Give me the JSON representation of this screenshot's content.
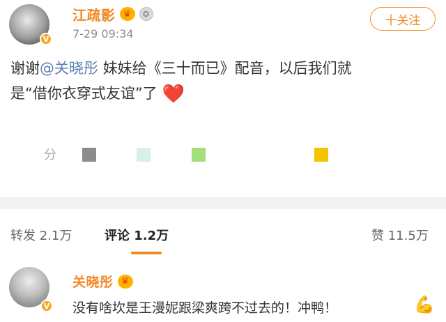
{
  "post": {
    "username": "江疏影",
    "timestamp": "7-29 09:34",
    "follow_label": "十关注",
    "text_line1_prefix": "谢谢",
    "mention": "@关晓彤",
    "text_line1_suffix": "妹妹给《三十而已》配音，以后我们就",
    "text_line2": "是“借你衣穿式友谊”了",
    "share_fragment": "分",
    "heart_emoji": "❤️",
    "color_squares": [
      "#8c8c8c",
      "#d8f0ea",
      "#a3de7a",
      "#f5c400"
    ]
  },
  "stats": {
    "repost_label": "转发",
    "repost_count": "2.1万",
    "comment_label": "评论",
    "comment_count": "1.2万",
    "like_label": "赞",
    "like_count": "11.5万"
  },
  "comment": {
    "username": "关晓彤",
    "text": "没有啥坎是王漫妮跟梁爽跨不过去的！冲鸭！",
    "emoji": "💪"
  },
  "colors": {
    "accent": "#f08a24",
    "mention": "#5b7fb5",
    "divider": "#f2f2f2"
  }
}
